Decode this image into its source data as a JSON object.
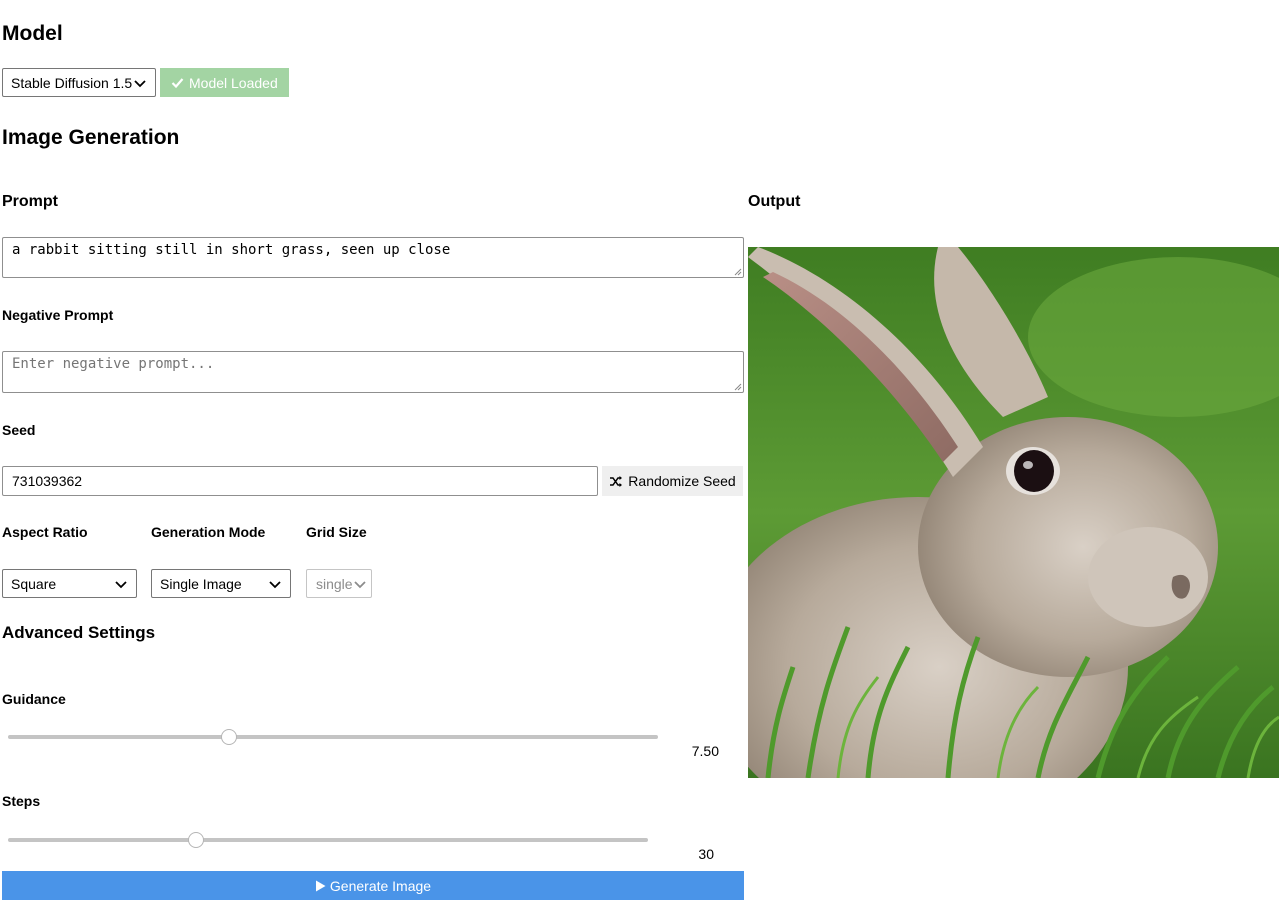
{
  "model": {
    "heading": "Model",
    "selected": "Stable Diffusion 1.5",
    "status": "Model Loaded",
    "status_color": "#a3d4a3"
  },
  "generation": {
    "heading": "Image Generation"
  },
  "prompt": {
    "label": "Prompt",
    "value": "a rabbit sitting still in short grass, seen up close"
  },
  "negative_prompt": {
    "label": "Negative Prompt",
    "placeholder": "Enter negative prompt..."
  },
  "seed": {
    "label": "Seed",
    "value": "731039362",
    "randomize_label": "Randomize Seed"
  },
  "aspect_ratio": {
    "label": "Aspect Ratio",
    "selected": "Square"
  },
  "generation_mode": {
    "label": "Generation Mode",
    "selected": "Single Image"
  },
  "grid_size": {
    "label": "Grid Size",
    "selected": "single"
  },
  "advanced": {
    "heading": "Advanced Settings"
  },
  "guidance": {
    "label": "Guidance",
    "value": "7.50",
    "fraction": 0.34
  },
  "steps": {
    "label": "Steps",
    "value": "30",
    "fraction": 0.294
  },
  "generate_button": {
    "label": "Generate Image",
    "color": "#4a94e8"
  },
  "output": {
    "label": "Output",
    "image": "rabbit-in-grass-photo"
  }
}
